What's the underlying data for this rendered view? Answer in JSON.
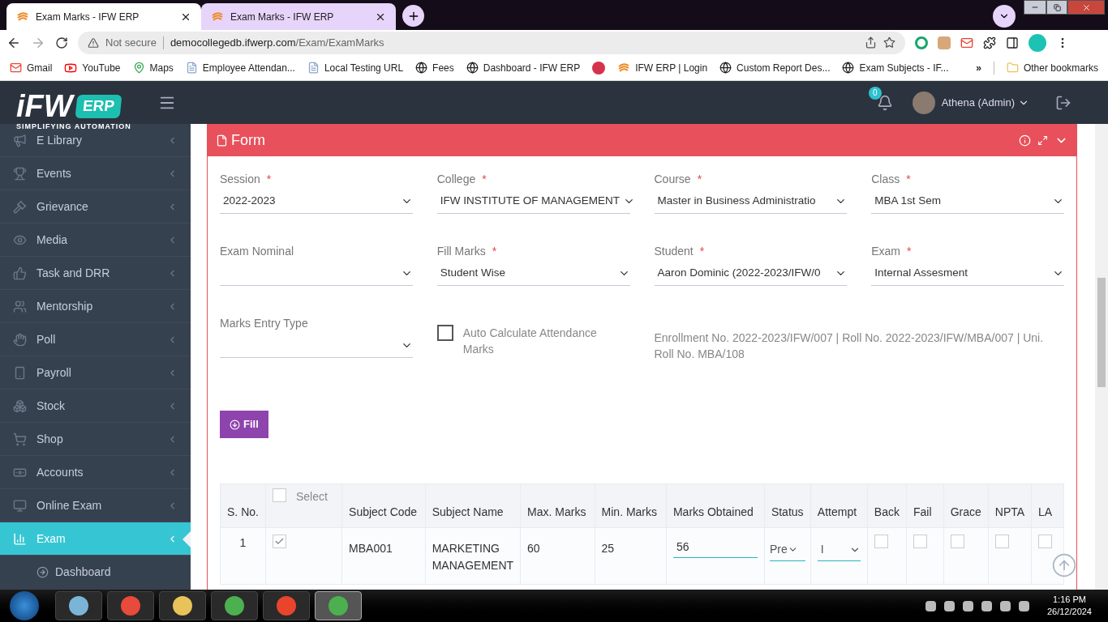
{
  "browser": {
    "tabs": [
      {
        "title": "Exam Marks - IFW ERP",
        "selected": true
      },
      {
        "title": "Exam Marks - IFW ERP",
        "selected": false
      }
    ],
    "security": "Not secure",
    "url_host": "democollegedb.ifwerp.com",
    "url_path": "/Exam/ExamMarks",
    "bookmarks": [
      {
        "label": "Gmail",
        "kind": "gmail"
      },
      {
        "label": "YouTube",
        "kind": "youtube"
      },
      {
        "label": "Maps",
        "kind": "maps"
      },
      {
        "label": "Employee Attendan...",
        "kind": "page"
      },
      {
        "label": "Local Testing URL",
        "kind": "page"
      },
      {
        "label": "Fees",
        "kind": "globe"
      },
      {
        "label": "Dashboard - IFW ERP",
        "kind": "globe"
      },
      {
        "kind": "app"
      },
      {
        "label": "IFW ERP | Login",
        "kind": "ifw"
      },
      {
        "label": "Custom Report Des...",
        "kind": "globe"
      },
      {
        "label": "Exam Subjects - IF...",
        "kind": "globe"
      }
    ],
    "more": "»",
    "other_bookmarks": "Other bookmarks"
  },
  "header": {
    "logo_main": "iFW",
    "logo_badge": "ERP",
    "tagline": "SIMPLIFYING AUTOMATION",
    "notification_count": "0",
    "user": "Athena (Admin)"
  },
  "sidebar": {
    "items": [
      {
        "label": "E Library",
        "selected": false
      },
      {
        "label": "Events",
        "selected": false
      },
      {
        "label": "Grievance",
        "selected": false
      },
      {
        "label": "Media",
        "selected": false
      },
      {
        "label": "Task and DRR",
        "selected": false
      },
      {
        "label": "Mentorship",
        "selected": false
      },
      {
        "label": "Poll",
        "selected": false
      },
      {
        "label": "Payroll",
        "selected": false
      },
      {
        "label": "Stock",
        "selected": false
      },
      {
        "label": "Shop",
        "selected": false
      },
      {
        "label": "Accounts",
        "selected": false
      },
      {
        "label": "Online Exam",
        "selected": false
      },
      {
        "label": "Exam",
        "selected": true,
        "children": [
          {
            "label": "Dashboard",
            "selected": false
          }
        ]
      }
    ]
  },
  "form": {
    "title": "Form",
    "required_mark": "*",
    "fields": [
      {
        "label": "Session",
        "required": true,
        "value": "2022-2023"
      },
      {
        "label": "College",
        "required": true,
        "value": "IFW INSTITUTE OF MANAGEMENT"
      },
      {
        "label": "Course",
        "required": true,
        "value": "Master in Business Administratio"
      },
      {
        "label": "Class",
        "required": true,
        "value": "MBA 1st Sem"
      },
      {
        "label": "Exam Nominal",
        "required": false
      },
      {
        "label": "Fill Marks",
        "required": true,
        "value": "Student Wise"
      },
      {
        "label": "Student",
        "required": true,
        "value": "Aaron Dominic (2022-2023/IFW/0"
      },
      {
        "label": "Exam",
        "required": true,
        "value": "Internal Assesment"
      },
      {
        "label": "Marks Entry Type",
        "required": false
      }
    ],
    "auto_calculate": {
      "label": "Auto Calculate Attendance Marks",
      "checked": false
    },
    "student_info": "Enrollment No. 2022-2023/IFW/007 | Roll No. 2022-2023/IFW/MBA/007 | Uni. Roll No. MBA/108",
    "fill_button": "Fill"
  },
  "table": {
    "columns": [
      "S. No.",
      "Select",
      "Subject Code",
      "Subject Name",
      "Max. Marks",
      "Min. Marks",
      "Marks Obtained",
      "Status",
      "Attempt",
      "Back",
      "Fail",
      "Grace",
      "NPTA",
      "LA"
    ],
    "select_all_checked": false,
    "rows": [
      {
        "s_no": "1",
        "selected": true,
        "subject_code": "MBA001",
        "subject_name": "MARKETING MANAGEMENT",
        "max_marks": "60",
        "min_marks": "25",
        "marks_obtained": "56",
        "status": "Pre",
        "attempt": "I",
        "back": false,
        "fail": false,
        "grace": false,
        "npta": false,
        "la": false
      }
    ]
  },
  "taskbar": {
    "time": "1:16 PM",
    "date": "26/12/2024"
  }
}
